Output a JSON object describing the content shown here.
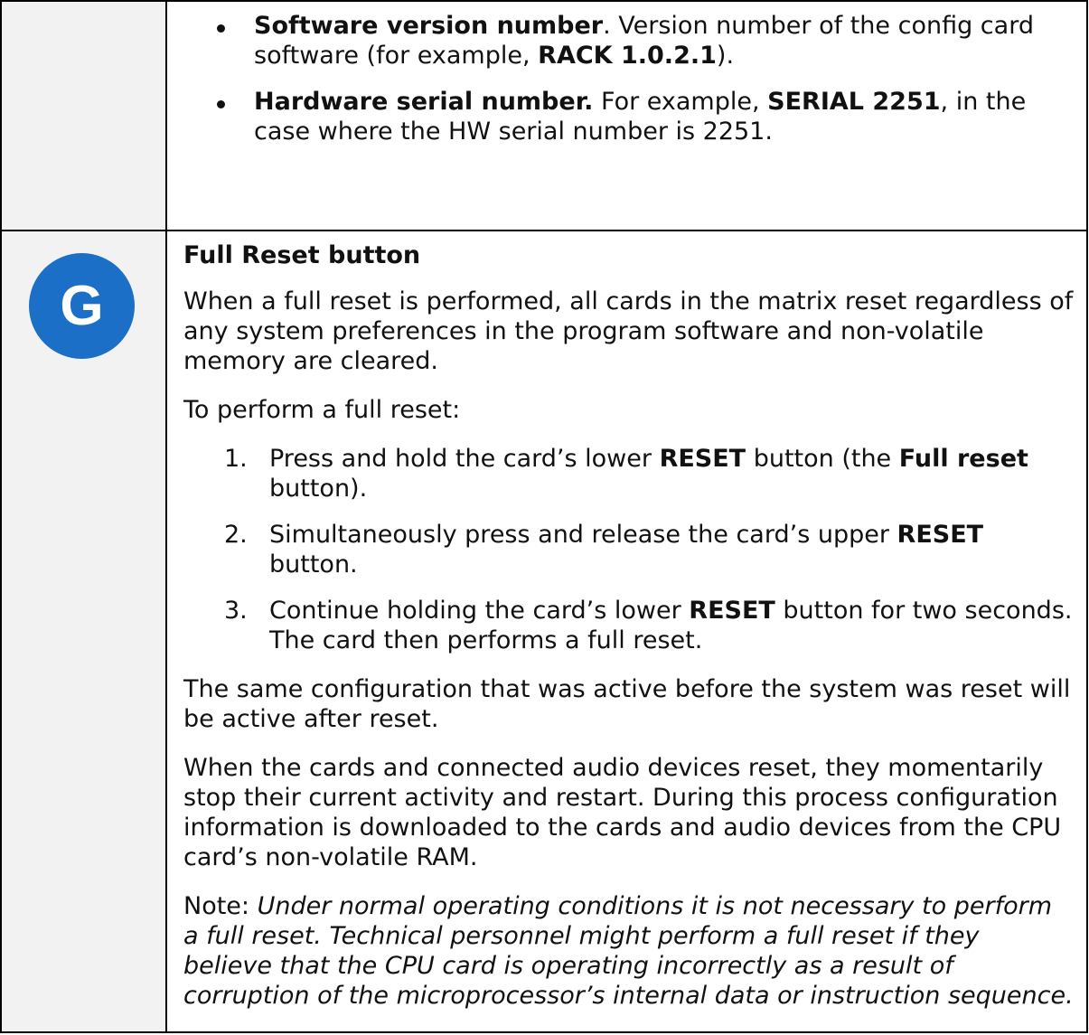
{
  "row1": {
    "bullets": [
      {
        "bold": "Software version number",
        "text1": ". Version number of the config card software (for example, ",
        "bold2": "RACK 1.0.2.1",
        "text2": ")."
      },
      {
        "bold": "Hardware serial number.",
        "text1": " For example, ",
        "bold2": "SERIAL 2251",
        "text2": ", in the case where the HW serial number is 2251."
      }
    ]
  },
  "row2": {
    "badge_letter": "G",
    "badge_color": "#1b6fc7",
    "heading": "Full Reset button",
    "para1": "When a full reset is performed, all cards in the matrix reset regardless of any system preferences in the program software and non-volatile memory are cleared.",
    "para2": "To perform a full reset:",
    "steps": [
      {
        "num": "1.",
        "t1": "Press and hold the card’s lower ",
        "b1": "RESET",
        "t2": " button (the ",
        "b2": "Full reset",
        "t3": " button)."
      },
      {
        "num": "2.",
        "t1": "Simultaneously press and release the card’s upper ",
        "b1": "RESET",
        "t2": " button."
      },
      {
        "num": "3.",
        "t1": "Continue holding the card’s lower ",
        "b1": "RESET",
        "t2": " button for two seconds.",
        "line2": "The card then performs a full reset."
      }
    ],
    "para3": "The same configuration that was active before the system was reset will be active after reset.",
    "para4": "When the cards and connected audio devices reset, they momentarily stop their current activity and restart. During this process configuration information is downloaded to the cards and audio devices from the CPU card’s non-volatile RAM.",
    "note_label": "Note: ",
    "note_text": "Under normal operating conditions it is not necessary to perform a full reset. Technical personnel might perform a full reset if they believe that the CPU card is operating incorrectly as a result of corruption of the microprocessor’s internal data or instruction sequence."
  }
}
